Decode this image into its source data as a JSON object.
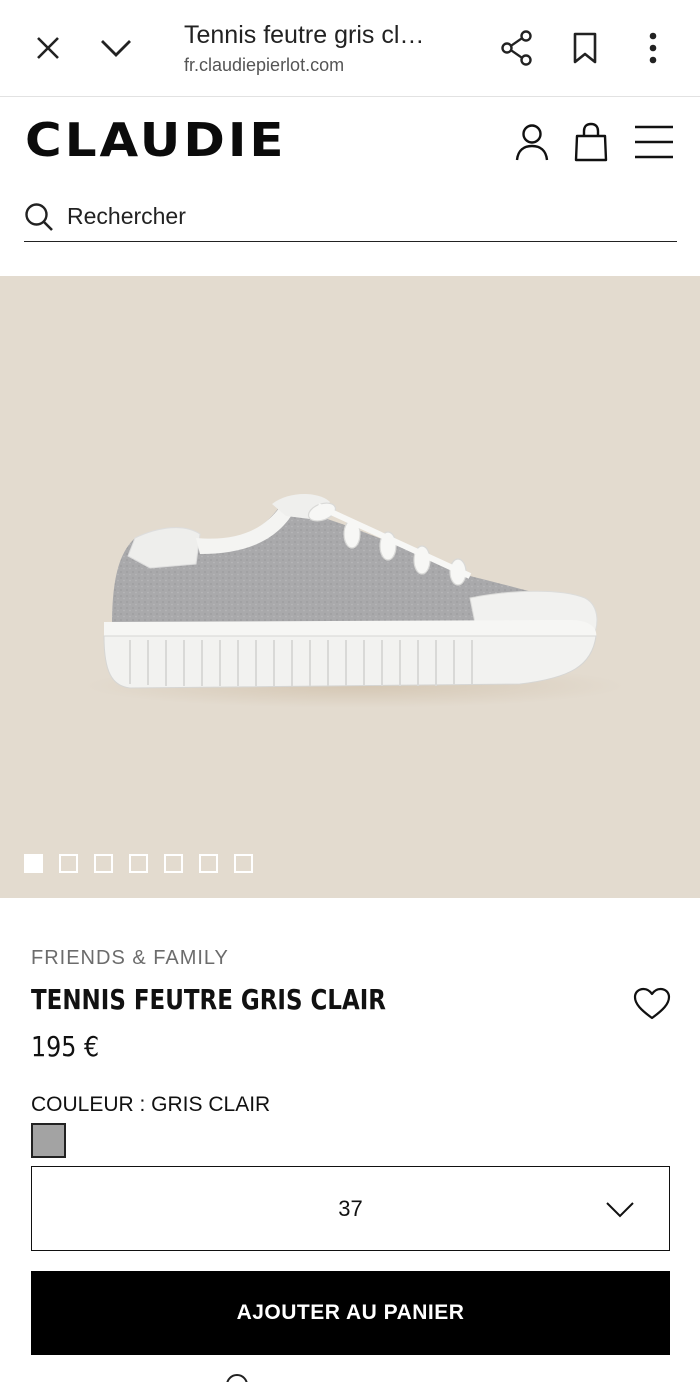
{
  "browser": {
    "tab_title": "Tennis feutre gris cl…",
    "url": "fr.claudiepierlot.com",
    "icons": [
      "close-icon",
      "chevron-down-icon",
      "share-icon",
      "bookmark-icon",
      "more-vert-icon"
    ]
  },
  "site": {
    "logo": "CLAUDIE",
    "header_icons": [
      "user-icon",
      "shopping-bag-icon",
      "hamburger-menu-icon"
    ],
    "search": {
      "placeholder": "Rechercher",
      "icon": "search-icon"
    }
  },
  "gallery": {
    "image": "gray felt low-top sneaker with white laces and ribbed white sole",
    "background_color": "#e3dbcf",
    "slide_count": 7,
    "active_slide": 1
  },
  "product": {
    "collection": "FRIENDS & FAMILY",
    "name": "TENNIS FEUTRE GRIS CLAIR",
    "price": "195 €",
    "wishlist_icon": "heart-icon",
    "color_label": "COULEUR : GRIS CLAIR",
    "color_swatch": "#a3a3a3",
    "size_selected": "37",
    "add_to_cart": "AJOUTER AU PANIER"
  }
}
